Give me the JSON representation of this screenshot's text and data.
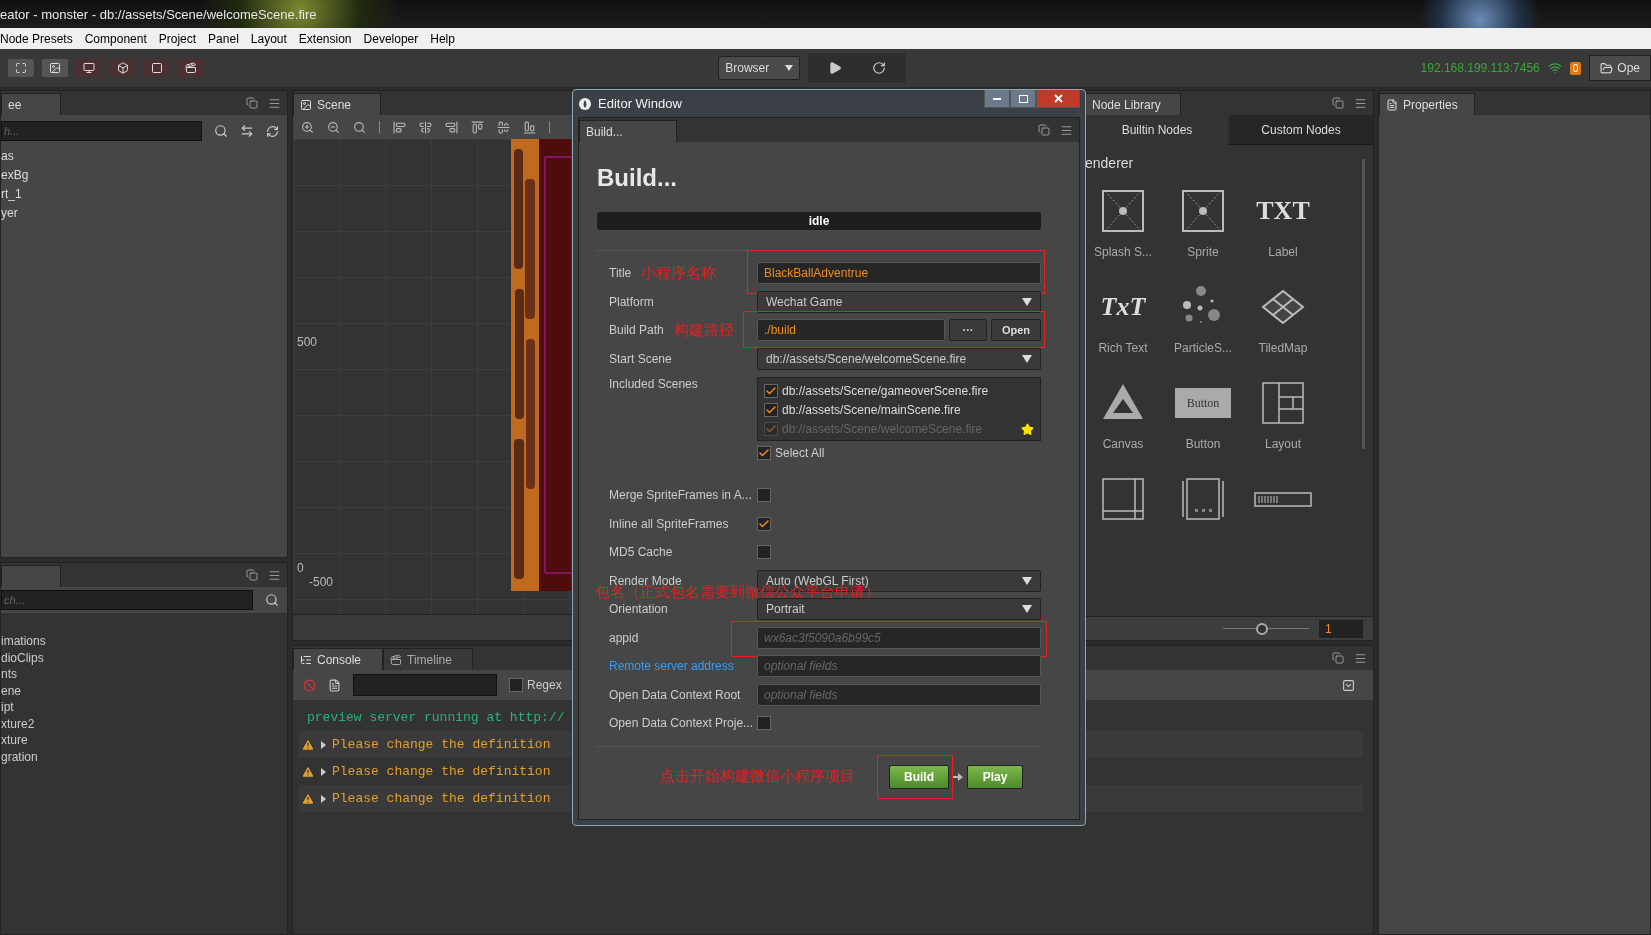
{
  "window": {
    "title": "eator - monster - db://assets/Scene/welcomeScene.fire"
  },
  "menu": [
    "Node Presets",
    "Component",
    "Project",
    "Panel",
    "Layout",
    "Extension",
    "Developer",
    "Help"
  ],
  "toolbar": {
    "platform": "Browser",
    "server": "192.168.199.113:7456",
    "badge": "0",
    "open_button": "Ope"
  },
  "hierarchy": {
    "tab": "ee",
    "placeholder": "h...",
    "nodes": [
      "as",
      "exBg",
      "rt_1",
      "yer"
    ]
  },
  "assets": {
    "placeholder": "ch...",
    "items": [
      "imations",
      "dioClips",
      "nts",
      "ene",
      "ipt",
      "xture2",
      "xture",
      "gration"
    ]
  },
  "scene": {
    "tab": "Scene",
    "ruler_labels": [
      "500",
      "0",
      "-500"
    ]
  },
  "console": {
    "tabs": [
      {
        "label": "Console",
        "selected": true
      },
      {
        "label": "Timeline",
        "selected": false
      }
    ],
    "regex": {
      "label": "Regex",
      "checked": false
    },
    "lines": [
      {
        "kind": "info",
        "text": "preview server running at http://"
      },
      {
        "kind": "warning",
        "text": "Please change the definition"
      },
      {
        "kind": "warning",
        "text": "Please change the definition"
      },
      {
        "kind": "warning",
        "text": "Please change the definition"
      }
    ]
  },
  "node_library": {
    "tab": "Node Library",
    "tabs": [
      {
        "label": "Builtin Nodes",
        "selected": true
      },
      {
        "label": "Custom Nodes",
        "selected": false
      }
    ],
    "section": "enderer",
    "nodes": [
      {
        "kind": "sprite",
        "label": "Splash S..."
      },
      {
        "kind": "sprite",
        "label": "Sprite"
      },
      {
        "kind": "txt",
        "label": "Label",
        "icon_text": "TXT"
      },
      {
        "kind": "richtext",
        "label": "Rich Text",
        "icon_text": "TxT"
      },
      {
        "kind": "particle",
        "label": "ParticleS..."
      },
      {
        "kind": "tiledmap",
        "label": "TiledMap"
      },
      {
        "kind": "canvas",
        "label": "Canvas"
      },
      {
        "kind": "button",
        "label": "Button",
        "icon_text": "Button"
      },
      {
        "kind": "layout",
        "label": "Layout"
      },
      {
        "kind": "scrollview"
      },
      {
        "kind": "pageview"
      },
      {
        "kind": "progressbar"
      }
    ],
    "zoom": {
      "level": 0.45,
      "value": "1"
    }
  },
  "properties": {
    "tab": "Properties"
  },
  "build_dialog": {
    "title": "Editor Window",
    "tab": "Build...",
    "heading": "Build...",
    "status": "idle",
    "fields": [
      {
        "kind": "text",
        "label": "Title",
        "value": "BlackBallAdventrue",
        "note": "小程序名称",
        "highlight": true
      },
      {
        "kind": "select",
        "label": "Platform",
        "value": "Wechat Game"
      },
      {
        "kind": "path",
        "label": "Build Path",
        "value": "./build",
        "browse": "···",
        "open": "Open",
        "note": "构建路径",
        "highlight": true
      },
      {
        "kind": "select",
        "label": "Start Scene",
        "value": "db://assets/Scene/welcomeScene.fire"
      },
      {
        "kind": "scenes",
        "label": "Included Scenes",
        "scenes": [
          {
            "path": "db://assets/Scene/gameoverScene.fire",
            "checked": true,
            "disabled": false,
            "starred": false
          },
          {
            "path": "db://assets/Scene/mainScene.fire",
            "checked": true,
            "disabled": false,
            "starred": false
          },
          {
            "path": "db://assets/Scene/welcomeScene.fire",
            "checked": true,
            "disabled": true,
            "starred": true
          }
        ],
        "select_all": {
          "label": "Select All",
          "checked": true
        }
      },
      {
        "kind": "checkbox",
        "label": "Merge SpriteFrames in A...",
        "checked": false
      },
      {
        "kind": "checkbox",
        "label": "Inline all SpriteFrames",
        "checked": true
      },
      {
        "kind": "checkbox",
        "label": "MD5 Cache",
        "checked": false
      },
      {
        "kind": "select",
        "label": "Render Mode",
        "value": "Auto (WebGL First)"
      },
      {
        "kind": "select",
        "label": "Orientation",
        "value": "Portrait",
        "note_above": "包名（正式包名需要到微信公众平台申请）"
      },
      {
        "kind": "text",
        "label": "appid",
        "placeholder": "wx6ac3f5090a6b99c5",
        "highlight": true
      },
      {
        "kind": "text",
        "label": "Remote server address",
        "link": true,
        "placeholder": "optional fields"
      },
      {
        "kind": "text",
        "label": "Open Data Context Root",
        "placeholder": "optional fields"
      },
      {
        "kind": "checkbox",
        "label": "Open Data Context Proje...",
        "checked": false
      }
    ],
    "footer_note": "点击开始构建微信小程序项目",
    "buttons": [
      {
        "kind": "build",
        "label": "Build",
        "highlight": true
      },
      {
        "kind": "play",
        "label": "Play",
        "highlight": false
      }
    ]
  }
}
